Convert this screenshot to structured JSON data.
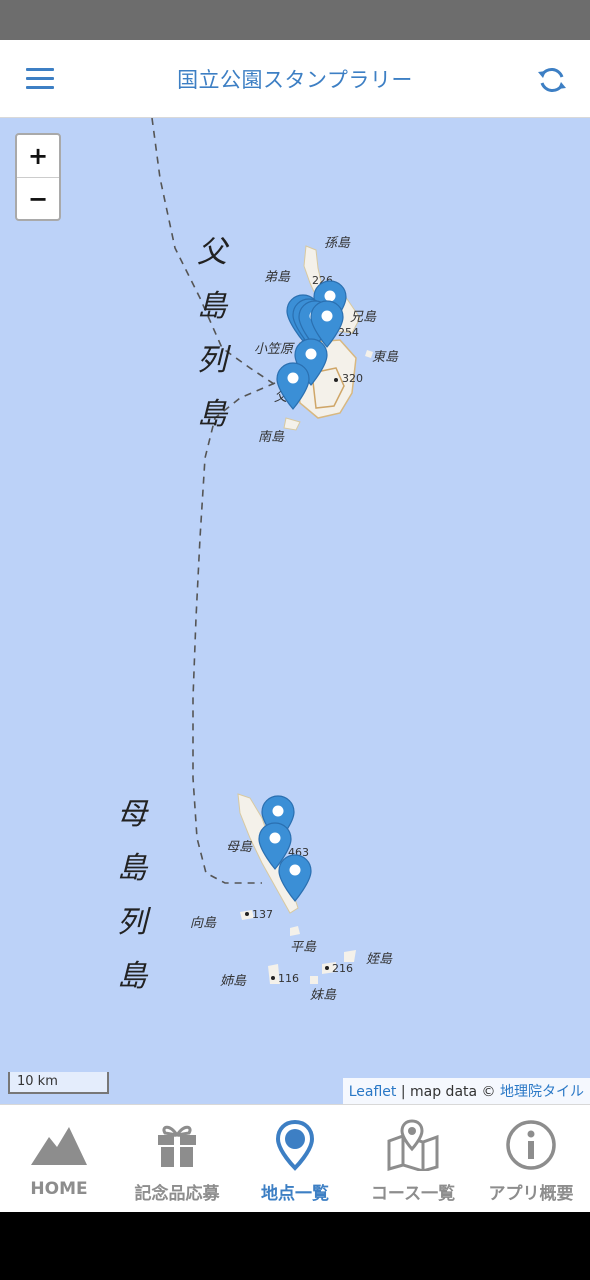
{
  "header": {
    "title": "国立公園スタンプラリー",
    "menu_icon": "menu-icon",
    "refresh_icon": "refresh-icon",
    "accent_color": "#3d7fc4"
  },
  "map": {
    "zoom_in": "+",
    "zoom_out": "−",
    "group_labels": {
      "chichijima": [
        "父",
        "島",
        "列",
        "島"
      ],
      "hahajima": [
        "母",
        "島",
        "列",
        "島"
      ]
    },
    "island_labels": {
      "magojima": "孫島",
      "ototojima": "弟島",
      "anijima": "兄島",
      "ogasawara": "小笠原",
      "higashijima": "東島",
      "chichijima_short": "父",
      "minamijima": "南島",
      "hahajima": "母島",
      "mukojima": "向島",
      "hirashima": "平島",
      "meijima": "姪島",
      "anejima": "姉島",
      "imotojima": "妹島"
    },
    "elevations": {
      "e226": "226",
      "e254": "254",
      "e320": "320",
      "e463": "463",
      "e137": "137",
      "e116": "116",
      "e216": "216"
    },
    "scale_label": "10 km",
    "attribution": {
      "leaflet": "Leaflet",
      "separator": " | map data © ",
      "source": "地理院タイル"
    },
    "pin_color": "#3b8fd6"
  },
  "nav": {
    "items": [
      {
        "label": "HOME",
        "icon": "mountain-icon",
        "active": false
      },
      {
        "label": "記念品応募",
        "icon": "gift-icon",
        "active": false
      },
      {
        "label": "地点一覧",
        "icon": "map-pin-icon",
        "active": true
      },
      {
        "label": "コース一覧",
        "icon": "map-route-icon",
        "active": false
      },
      {
        "label": "アプリ概要",
        "icon": "info-icon",
        "active": false
      }
    ]
  }
}
